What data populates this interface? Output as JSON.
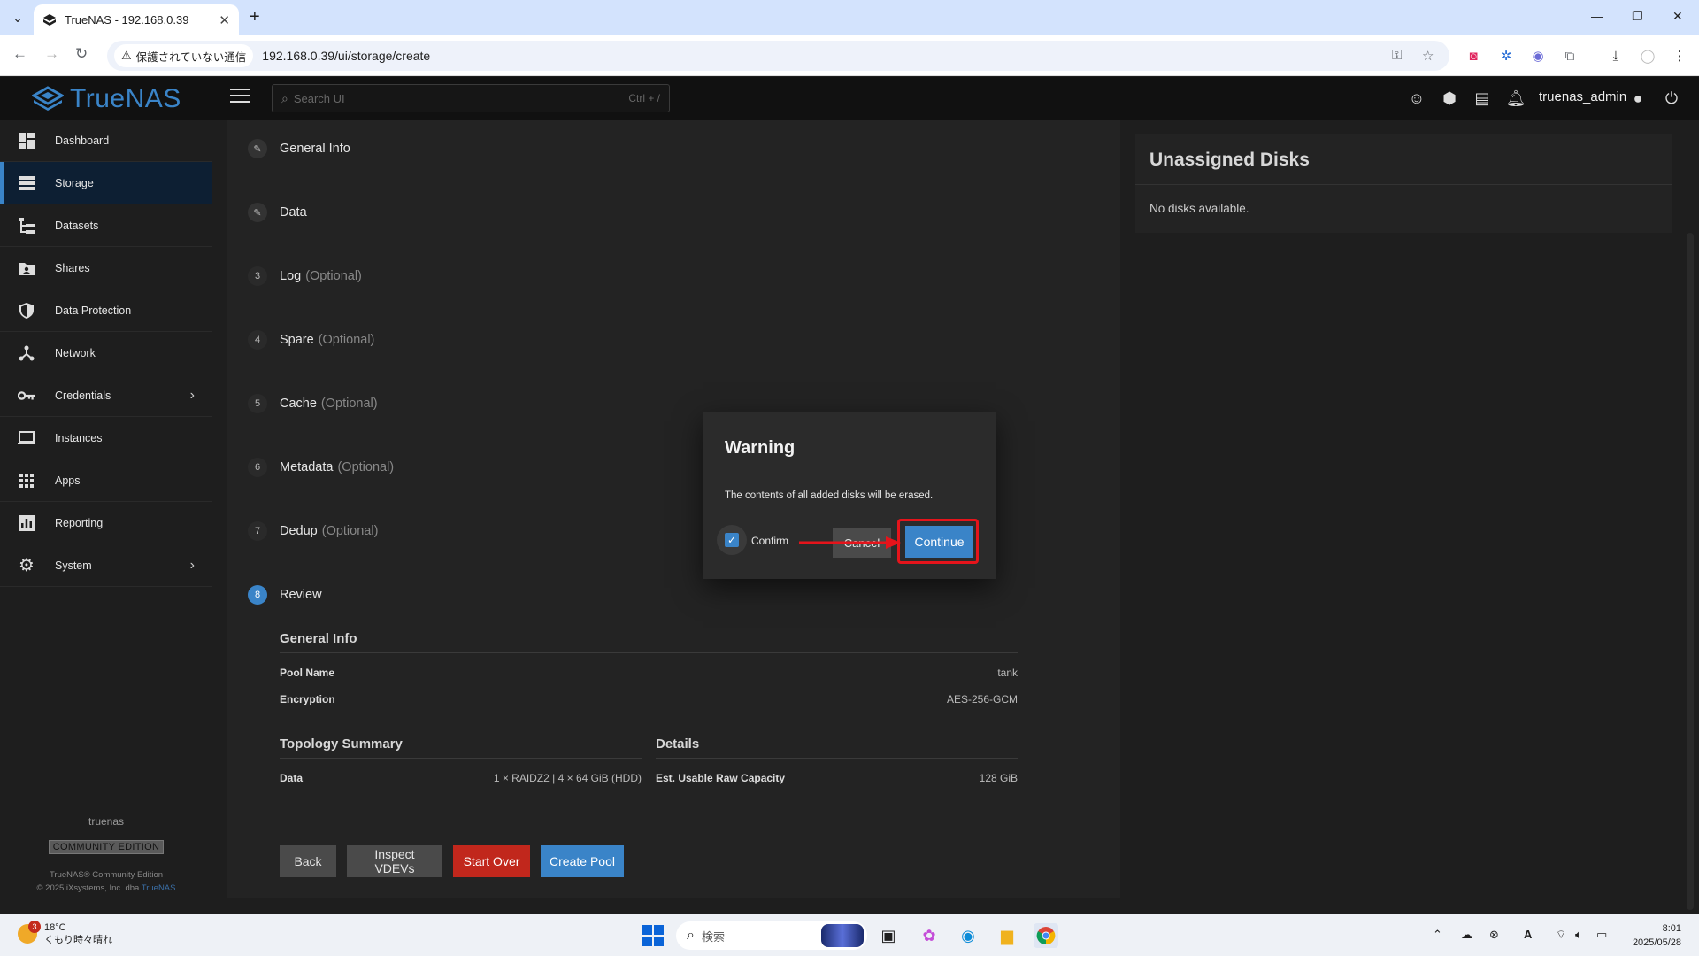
{
  "browser": {
    "tab_title": "TrueNAS - 192.168.0.39",
    "security_label": "保護されていない通信",
    "url": "192.168.0.39/ui/storage/create"
  },
  "header": {
    "logo_text": "TrueNAS",
    "search_placeholder": "Search UI",
    "search_shortcut": "Ctrl + /",
    "username": "truenas_admin"
  },
  "sidebar": {
    "items": [
      {
        "label": "Dashboard",
        "icon": "dashboard-icon"
      },
      {
        "label": "Storage",
        "icon": "storage-icon",
        "active": true
      },
      {
        "label": "Datasets",
        "icon": "datasets-icon"
      },
      {
        "label": "Shares",
        "icon": "shares-icon"
      },
      {
        "label": "Data Protection",
        "icon": "shield-icon"
      },
      {
        "label": "Network",
        "icon": "network-icon"
      },
      {
        "label": "Credentials",
        "icon": "key-icon",
        "expandable": true
      },
      {
        "label": "Instances",
        "icon": "laptop-icon"
      },
      {
        "label": "Apps",
        "icon": "apps-grid-icon"
      },
      {
        "label": "Reporting",
        "icon": "chart-icon"
      },
      {
        "label": "System",
        "icon": "gear-icon",
        "expandable": true
      }
    ],
    "hostname": "truenas",
    "edition": "COMMUNITY EDITION",
    "copyright_line1": "TrueNAS® Community Edition",
    "copyright_line2": "© 2025 iXsystems, Inc. dba",
    "copyright_link": "TrueNAS"
  },
  "stepper": {
    "steps": [
      {
        "badge": "✎",
        "label": "General Info",
        "optional": ""
      },
      {
        "badge": "✎",
        "label": "Data",
        "optional": ""
      },
      {
        "badge": "3",
        "label": "Log",
        "optional": "(Optional)"
      },
      {
        "badge": "4",
        "label": "Spare",
        "optional": "(Optional)"
      },
      {
        "badge": "5",
        "label": "Cache",
        "optional": "(Optional)"
      },
      {
        "badge": "6",
        "label": "Metadata",
        "optional": "(Optional)"
      },
      {
        "badge": "7",
        "label": "Dedup",
        "optional": "(Optional)"
      },
      {
        "badge": "8",
        "label": "Review",
        "optional": ""
      }
    ]
  },
  "review": {
    "general_title": "General Info",
    "pool_name_label": "Pool Name",
    "pool_name_value": "tank",
    "encryption_label": "Encryption",
    "encryption_value": "AES-256-GCM",
    "topology_title": "Topology Summary",
    "data_label": "Data",
    "data_value": "1 × RAIDZ2 | 4 × 64 GiB (HDD)",
    "details_title": "Details",
    "capacity_label": "Est. Usable Raw Capacity",
    "capacity_value": "128 GiB"
  },
  "buttons": {
    "back": "Back",
    "inspect": "Inspect VDEVs",
    "start_over": "Start Over",
    "create_pool": "Create Pool"
  },
  "unassigned": {
    "title": "Unassigned Disks",
    "empty": "No disks available."
  },
  "dialog": {
    "title": "Warning",
    "message": "The contents of all added disks will be erased.",
    "confirm_label": "Confirm",
    "confirm_checked": true,
    "cancel": "Cancel",
    "continue": "Continue"
  },
  "taskbar": {
    "weather_badge": "3",
    "temperature": "18°C",
    "weather_text": "くもり時々晴れ",
    "search_placeholder": "検索",
    "time": "8:01",
    "date": "2025/05/28"
  },
  "colors": {
    "accent": "#3a84c8",
    "danger": "#c1271c",
    "annotation": "#e5141b"
  }
}
